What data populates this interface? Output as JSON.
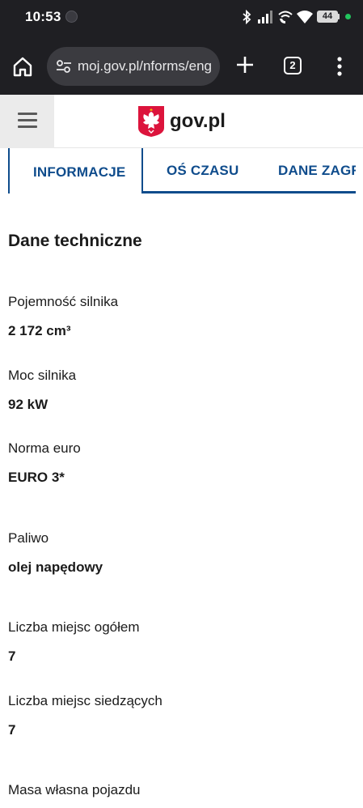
{
  "status_bar": {
    "time": "10:53",
    "battery": "44",
    "icons": [
      "bluetooth-icon",
      "signal-icon",
      "wifi-call-icon",
      "wifi-icon",
      "battery-icon"
    ]
  },
  "browser": {
    "url": "moj.gov.pl/nforms/eng",
    "tab_count": "2"
  },
  "site": {
    "logo_text": "gov.pl"
  },
  "tabs": [
    {
      "label": "INFORMACJE",
      "active": true
    },
    {
      "label": "OŚ CZASU",
      "active": false
    },
    {
      "label": "DANE ZAGR",
      "active": false
    }
  ],
  "section": {
    "title": "Dane techniczne",
    "fields": [
      {
        "label": "Pojemność silnika",
        "value": "2 172 cm³"
      },
      {
        "label": "Moc silnika",
        "value": "92 kW"
      },
      {
        "label": "Norma euro",
        "value": "EURO 3*"
      },
      {
        "label": "Paliwo",
        "value": "olej napędowy"
      },
      {
        "label": "Liczba miejsc ogółem",
        "value": "7"
      },
      {
        "label": "Liczba miejsc siedzących",
        "value": "7"
      },
      {
        "label": "Masa własna pojazdu",
        "value": ""
      }
    ]
  },
  "colors": {
    "accent": "#0f4c8c",
    "status_bar_bg": "#1f1f23",
    "url_bar_bg": "#3b3b40"
  }
}
